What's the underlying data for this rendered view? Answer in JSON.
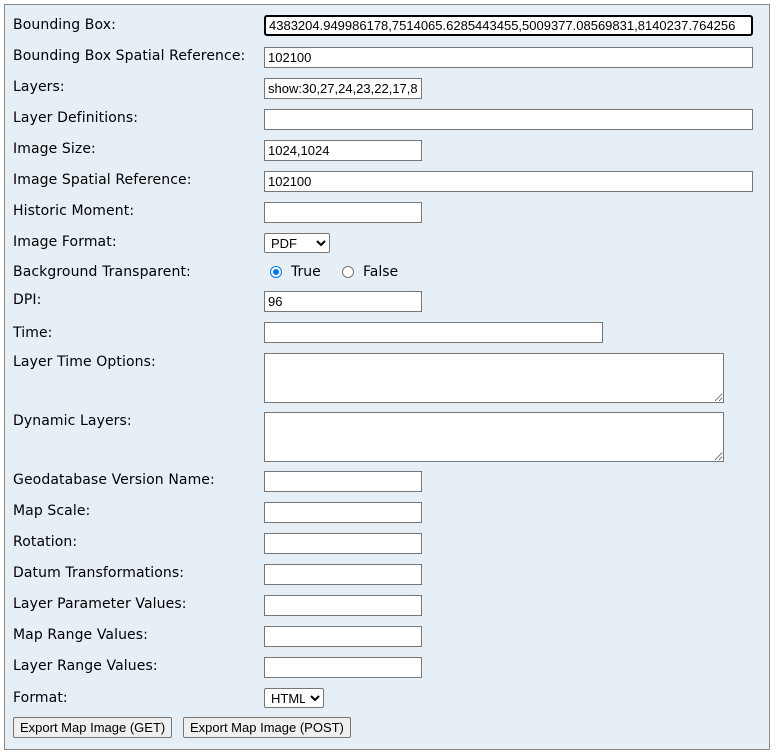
{
  "form": {
    "bounding_box": {
      "label": "Bounding Box:",
      "value": "4383204.949986178,7514065.6285443455,5009377.08569831,8140237.764256"
    },
    "bbox_sr": {
      "label": "Bounding Box Spatial Reference:",
      "value": "102100"
    },
    "layers": {
      "label": "Layers:",
      "value": "show:30,27,24,23,22,17,8"
    },
    "layer_defs": {
      "label": "Layer Definitions:",
      "value": ""
    },
    "image_size": {
      "label": "Image Size:",
      "value": "1024,1024"
    },
    "image_sr": {
      "label": "Image Spatial Reference:",
      "value": "102100"
    },
    "historic_moment": {
      "label": "Historic Moment:",
      "value": ""
    },
    "image_format": {
      "label": "Image Format:",
      "selected": "PDF"
    },
    "transparent": {
      "label": "Background Transparent:",
      "true_label": "True",
      "false_label": "False",
      "selected": "True"
    },
    "dpi": {
      "label": "DPI:",
      "value": "96"
    },
    "time": {
      "label": "Time:",
      "value": ""
    },
    "layer_time_options": {
      "label": "Layer Time Options:",
      "value": ""
    },
    "dynamic_layers": {
      "label": "Dynamic Layers:",
      "value": ""
    },
    "gdb_version": {
      "label": "Geodatabase Version Name:",
      "value": ""
    },
    "map_scale": {
      "label": "Map Scale:",
      "value": ""
    },
    "rotation": {
      "label": "Rotation:",
      "value": ""
    },
    "datum_transformations": {
      "label": "Datum Transformations:",
      "value": ""
    },
    "layer_param_values": {
      "label": "Layer Parameter Values:",
      "value": ""
    },
    "map_range_values": {
      "label": "Map Range Values:",
      "value": ""
    },
    "layer_range_values": {
      "label": "Layer Range Values:",
      "value": ""
    },
    "format": {
      "label": "Format:",
      "selected": "HTML"
    },
    "buttons": {
      "get_label": "Export Map Image (GET)",
      "post_label": "Export Map Image (POST)"
    }
  }
}
